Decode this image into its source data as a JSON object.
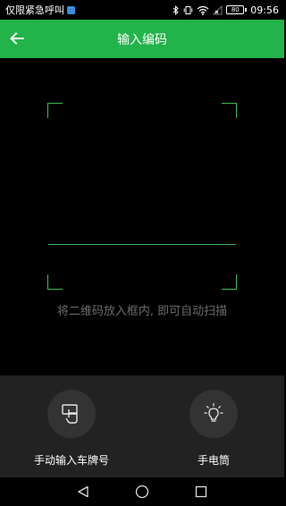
{
  "status_bar": {
    "carrier": "仅限紧急呼叫",
    "time": "09:56",
    "battery": "80"
  },
  "app_bar": {
    "title": "输入编码"
  },
  "scanner": {
    "hint": "将二维码放入框内, 即可自动扫描"
  },
  "actions": [
    {
      "label": "手动输入车牌号",
      "icon": "hand-pointer-icon"
    },
    {
      "label": "手电筒",
      "icon": "lightbulb-icon"
    }
  ],
  "colors": {
    "accent": "#22b34a",
    "frame": "#3fb950",
    "panel": "#222222",
    "hint_text": "#6b6b6b"
  }
}
